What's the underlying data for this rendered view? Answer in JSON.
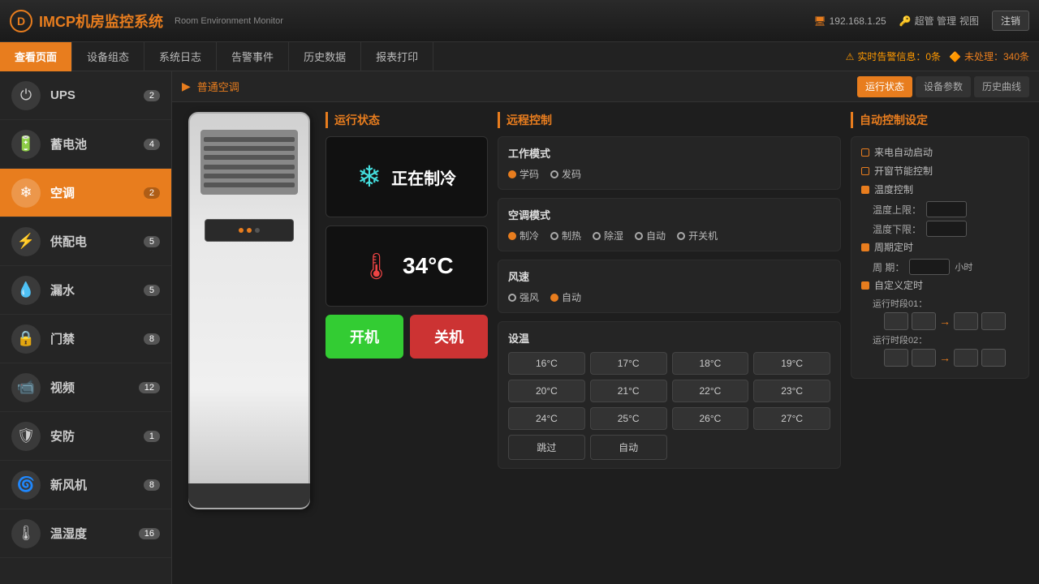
{
  "app": {
    "title": "IMCP机房监控系统",
    "subtitle": "Room Environment Monitor",
    "logo_char": "D",
    "ip": "192.168.1.25",
    "admin": "超管 管理",
    "role": "视图",
    "logout": "注销"
  },
  "nav": {
    "tabs": [
      {
        "label": "查看页面",
        "active": true
      },
      {
        "label": "设备组态",
        "active": false
      },
      {
        "label": "系统日志",
        "active": false
      },
      {
        "label": "告警事件",
        "active": false
      },
      {
        "label": "历史数据",
        "active": false
      },
      {
        "label": "报表打印",
        "active": false
      }
    ],
    "alert_warning": "实时告警信息：0条",
    "alert_pending": "未处理：340条"
  },
  "sidebar": {
    "items": [
      {
        "label": "UPS",
        "badge": "2",
        "icon": "⏻",
        "active": false
      },
      {
        "label": "蓄电池",
        "badge": "4",
        "icon": "🔋",
        "active": false
      },
      {
        "label": "空调",
        "badge": "2",
        "icon": "❄",
        "active": true
      },
      {
        "label": "供配电",
        "badge": "5",
        "icon": "⚡",
        "active": false
      },
      {
        "label": "漏水",
        "badge": "5",
        "icon": "💧",
        "active": false
      },
      {
        "label": "门禁",
        "badge": "8",
        "icon": "🔒",
        "active": false
      },
      {
        "label": "视频",
        "badge": "12",
        "icon": "📹",
        "active": false
      },
      {
        "label": "安防",
        "badge": "1",
        "icon": "🛡",
        "active": false
      },
      {
        "label": "新风机",
        "badge": "8",
        "icon": "🌀",
        "active": false
      },
      {
        "label": "温湿度",
        "badge": "16",
        "icon": "🌡",
        "active": false
      }
    ]
  },
  "breadcrumb": "普通空调",
  "header_btns": [
    {
      "label": "运行状态",
      "active": true
    },
    {
      "label": "设备参数",
      "active": false
    },
    {
      "label": "历史曲线",
      "active": false
    }
  ],
  "status_panel": {
    "title": "运行状态",
    "status_text": "正在制冷",
    "temp_value": "34°C",
    "btn_on": "开机",
    "btn_off": "关机"
  },
  "remote_panel": {
    "title": "远程控制",
    "work_mode": {
      "label": "工作模式",
      "options": [
        {
          "label": "学码",
          "checked": true
        },
        {
          "label": "发码",
          "checked": false
        }
      ]
    },
    "ac_mode": {
      "label": "空调模式",
      "options": [
        {
          "label": "制冷",
          "checked": true
        },
        {
          "label": "制热",
          "checked": false
        },
        {
          "label": "除湿",
          "checked": false
        },
        {
          "label": "自动",
          "checked": false
        },
        {
          "label": "开关机",
          "checked": false
        }
      ]
    },
    "fan_mode": {
      "label": "风速",
      "options": [
        {
          "label": "强风",
          "checked": false
        },
        {
          "label": "自动",
          "checked": true
        }
      ]
    },
    "temp_setting": {
      "label": "设温",
      "grid": [
        "16°C",
        "17°C",
        "18°C",
        "19°C",
        "20°C",
        "21°C",
        "22°C",
        "23°C",
        "24°C",
        "25°C",
        "26°C",
        "27°C",
        "跳过",
        "自动"
      ]
    }
  },
  "auto_panel": {
    "title": "自动控制设定",
    "items": [
      {
        "label": "来电自动启动",
        "checked": false
      },
      {
        "label": "开窗节能控制",
        "checked": false
      },
      {
        "label": "温度控制",
        "checked": true,
        "sub": [
          {
            "label": "温度上限：",
            "unit": ""
          },
          {
            "label": "温度下限：",
            "unit": ""
          }
        ]
      },
      {
        "label": "周期定时",
        "checked": true,
        "sub": [
          {
            "label": "周  期：",
            "unit": "小时"
          }
        ]
      },
      {
        "label": "自定义定时",
        "checked": true,
        "sub": [
          {
            "label": "运行时段01："
          },
          {
            "label": "运行时段02："
          }
        ]
      }
    ]
  }
}
